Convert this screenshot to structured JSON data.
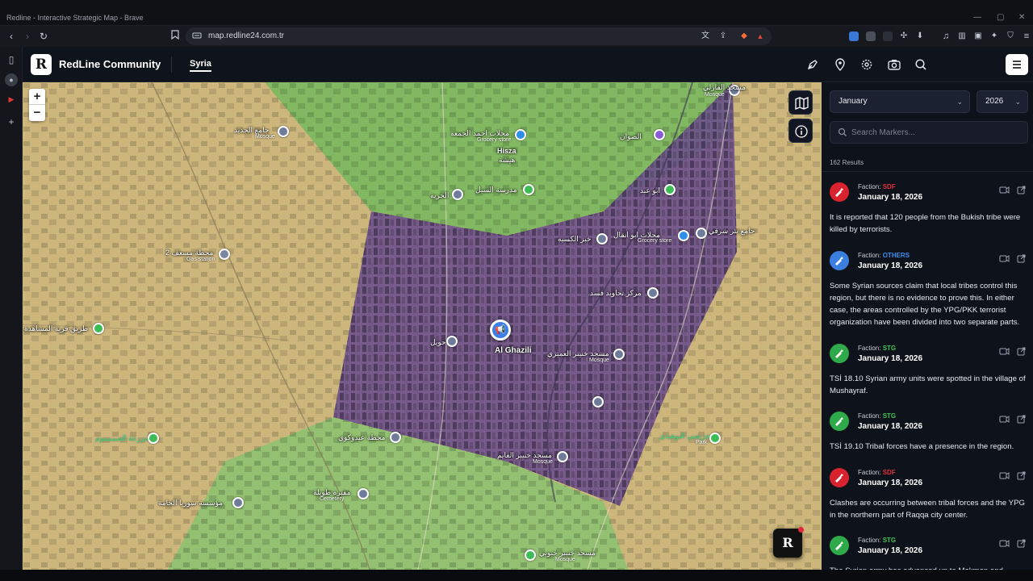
{
  "window": {
    "title": "Redline - Interactive Strategic Map - Brave"
  },
  "browser": {
    "url": "map.redline24.com.tr"
  },
  "app": {
    "brand": "RedLine Community",
    "logo_letter": "R",
    "nav": {
      "active": "Syria"
    }
  },
  "map": {
    "zoom_in": "+",
    "zoom_out": "−",
    "center_label": "Al Ghazili",
    "labels": [
      {
        "text": "مسجد القارلي",
        "sub": "Mosque"
      },
      {
        "text": "جامع الجديد",
        "sub": "Mosque"
      },
      {
        "text": "محلات احمد الجمعه",
        "sub": "Grocery store"
      },
      {
        "text": "Hisza"
      },
      {
        "text": "هيشة"
      },
      {
        "text": "الصوان"
      },
      {
        "text": "مدرسة السيل"
      },
      {
        "text": "الحرية"
      },
      {
        "text": "ابو عبد"
      },
      {
        "text": "محطة مسعف 2",
        "sub": "Gas station"
      },
      {
        "text": "خبز الكسيه"
      },
      {
        "text": "محلات ابو انقال",
        "sub": "Grocery store"
      },
      {
        "text": "جامع بئر شرقي"
      },
      {
        "text": "مركز تحاويد فسد"
      },
      {
        "text": "طريق قرية المشاهدة"
      },
      {
        "text": "مسجد خنيبر العميري",
        "sub": "Mosque"
      },
      {
        "text": "مزرعة الصممموم"
      },
      {
        "text": "محطة عيدوكوي"
      },
      {
        "text": "مسجد خنيبر العايم",
        "sub": "Mosque"
      },
      {
        "text": "خريصي البوهيدي",
        "sub": "Park"
      },
      {
        "text": "مقبرة طويلة",
        "sub": "Cemetery"
      },
      {
        "text": "مؤسسة سوريا الحامة"
      },
      {
        "text": "مسجد خنيبر حبوبي",
        "sub": "Mosque"
      },
      {
        "text": "حويل"
      }
    ],
    "zone_colors": {
      "sdf": "#7a5a9e",
      "stg": "#58b260",
      "neutral": "#d6bf7c"
    }
  },
  "panel": {
    "month": "January",
    "year": "2026",
    "search_placeholder": "Search Markers...",
    "results": "162 Results",
    "faction_prefix": "Faction:",
    "events": [
      {
        "faction": "SDF",
        "faction_color": "#e2313f",
        "icon_color": "#d8232f",
        "date": "January 18, 2026",
        "desc": "It is reported that 120 people from the Bukish tribe were killed by terrorists."
      },
      {
        "faction": "OTHERS",
        "faction_color": "#3d8ff2",
        "icon_color": "#3a7fe0",
        "date": "January 18, 2026",
        "desc": "Some Syrian sources claim that local tribes control this region, but there is no evidence to prove this. In either case, the areas controlled by the YPG/PKK terrorist organization have been divided into two separate parts."
      },
      {
        "faction": "STG",
        "faction_color": "#3ec457",
        "icon_color": "#2faa4b",
        "date": "January 18, 2026",
        "desc": "TSİ 18.10 Syrian army units were spotted in the village of Mushayraf."
      },
      {
        "faction": "STG",
        "faction_color": "#3ec457",
        "icon_color": "#2faa4b",
        "date": "January 18, 2026",
        "desc": "TSİ 19.10 Tribal forces have a presence in the region."
      },
      {
        "faction": "SDF",
        "faction_color": "#e2313f",
        "icon_color": "#d8232f",
        "date": "January 18, 2026",
        "desc": "Clashes are occurring between tribal forces and the YPG in the northern part of Raqqa city center."
      },
      {
        "faction": "STG",
        "faction_color": "#3ec457",
        "icon_color": "#2faa4b",
        "date": "January 18, 2026",
        "desc": "The Syrian army has advanced up to Makman and"
      }
    ]
  }
}
